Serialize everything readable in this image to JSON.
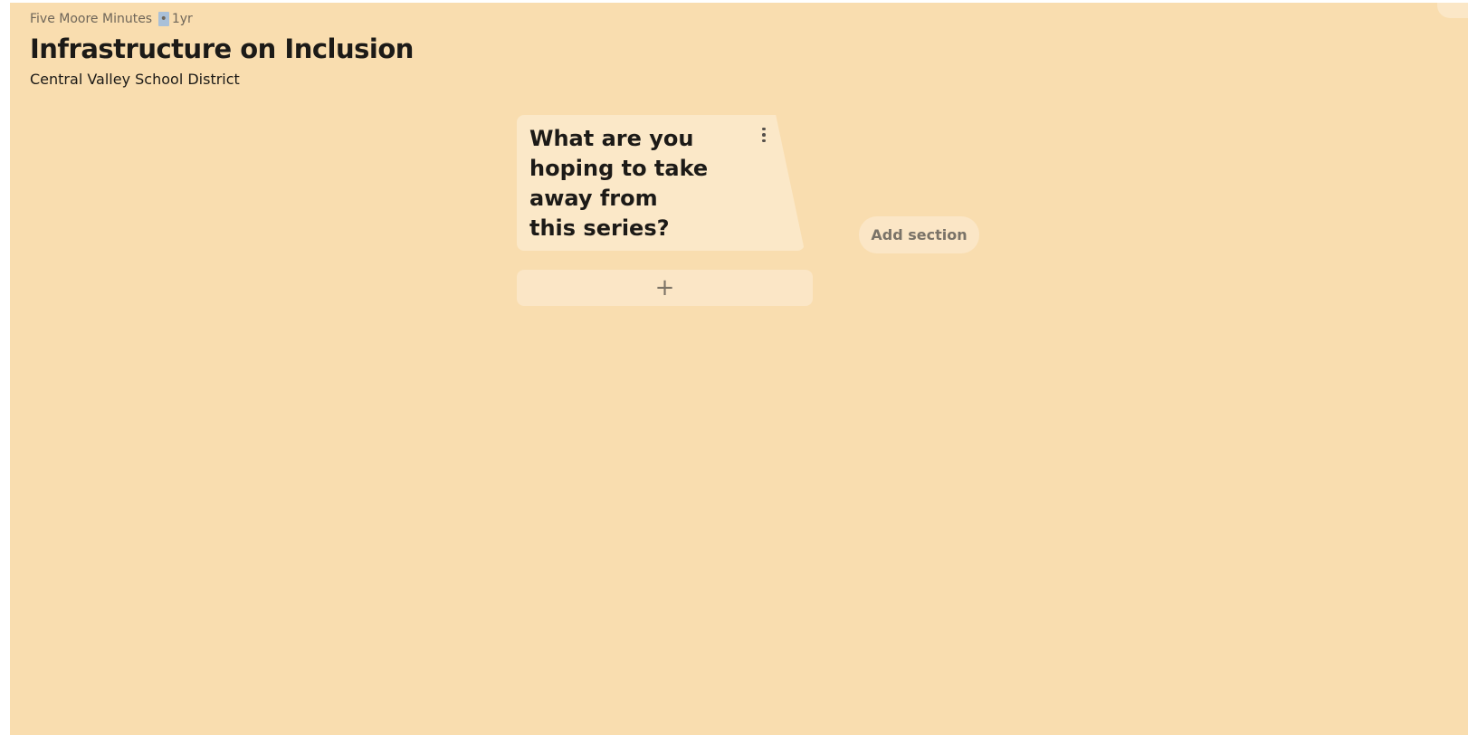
{
  "header": {
    "channel": "Five Moore Minutes",
    "separator": "•",
    "age": "1yr",
    "title": "Infrastructure on Inclusion",
    "subtitle": "Central Valley School District"
  },
  "sections": [
    {
      "card": {
        "text": "What are you hoping to take away from this series?",
        "menu_icon": "vertical-ellipsis-icon"
      },
      "add_card_label": "+"
    }
  ],
  "add_section_label": "Add section",
  "colors": {
    "board_background": "#f9ddaf",
    "card_background": "#fbe8c8",
    "text_primary": "#1c1a17",
    "text_muted": "#7a7368",
    "selection_highlight": "#a9c0d8"
  }
}
